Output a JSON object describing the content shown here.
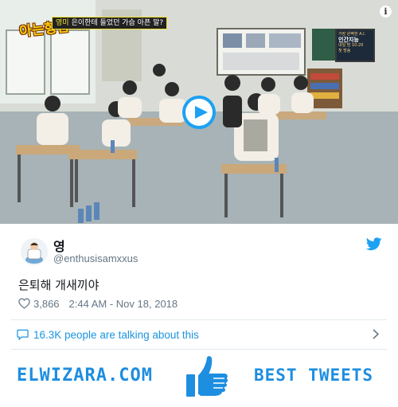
{
  "video": {
    "show_logo": "아는형님",
    "caption_highlight": "영미",
    "caption_text": "은이한테 들었던 가슴 아픈 말?",
    "tv_line1": "가장 완벽한 A.I.",
    "tv_big": "인간지능",
    "tv_line2": "내일 밤 10:20",
    "tv_line3": "첫 방송",
    "info_icon": "info-icon",
    "play_icon": "play-icon"
  },
  "tweet": {
    "user_name": "영",
    "user_handle": "@enthusisamxxus",
    "text": "은퇴해 개새끼야",
    "likes": "3,866",
    "timestamp": "2:44 AM - Nov 18, 2018",
    "talking": "16.3K people are talking about this"
  },
  "footer": {
    "brand_left": "ELWIZARA.COM",
    "brand_right": "BEST TWEETS"
  },
  "colors": {
    "twitter_blue": "#1da1f2",
    "link_blue": "#1b95e0",
    "brand_blue": "#1d8ee0",
    "muted": "#657786"
  }
}
